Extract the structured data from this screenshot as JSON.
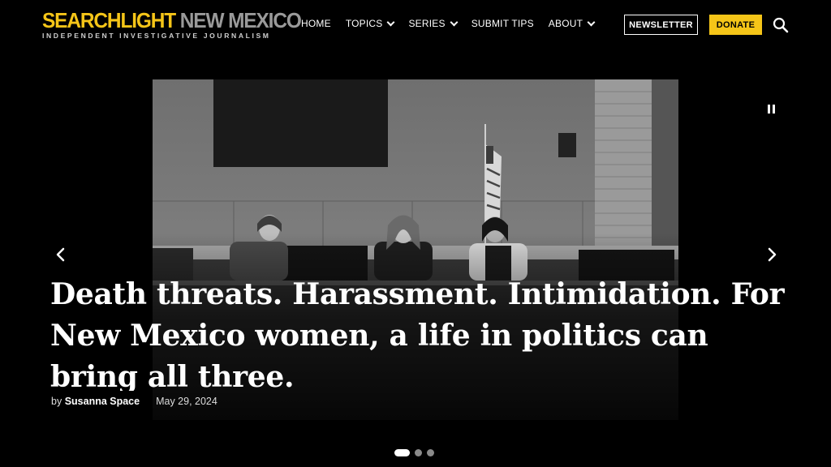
{
  "header": {
    "logo_part1": "SEARCH",
    "logo_part2": "LIGHT",
    "logo_part3": " NEW MEXICO",
    "tagline": "INDEPENDENT INVESTIGATIVE JOURNALISM",
    "nav": [
      {
        "label": "HOME",
        "dropdown": false
      },
      {
        "label": "TOPICS",
        "dropdown": true
      },
      {
        "label": "SERIES",
        "dropdown": true
      },
      {
        "label": "SUBMIT TIPS",
        "dropdown": false
      },
      {
        "label": "ABOUT",
        "dropdown": true
      }
    ],
    "newsletter_label": "NEWSLETTER",
    "donate_label": "DONATE",
    "search_icon": "search-icon"
  },
  "hero": {
    "headline": "Death threats. Harassment. Intimidation. For New Mexico women, a life in politics can bring all three.",
    "byline_prefix": "by",
    "author": "Susanna Space",
    "date": "May 29, 2024",
    "slide_count": 3,
    "active_slide": 1
  },
  "colors": {
    "accent": "#f5c518",
    "background": "#000000"
  }
}
